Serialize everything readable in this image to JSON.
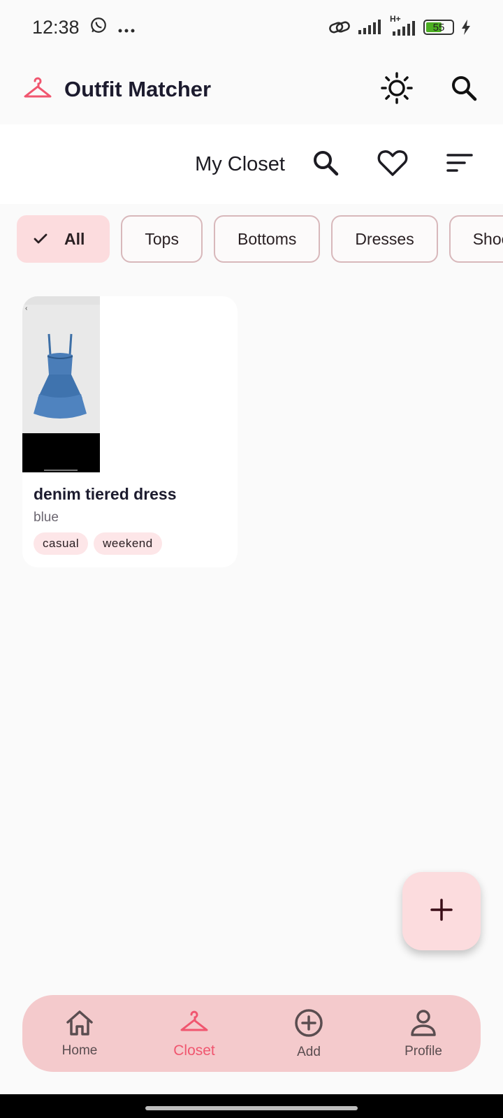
{
  "status_bar": {
    "time": "12:38",
    "notification_icons": [
      "whatsapp-icon",
      "more-dots-icon"
    ],
    "network_label": "H+",
    "battery_level": "55",
    "charging": true
  },
  "app_bar": {
    "title": "Outfit Matcher",
    "brand_color": "#f0566f"
  },
  "section": {
    "title": "My Closet"
  },
  "filters": {
    "chips": [
      {
        "label": "All",
        "selected": true
      },
      {
        "label": "Tops",
        "selected": false
      },
      {
        "label": "Bottoms",
        "selected": false
      },
      {
        "label": "Dresses",
        "selected": false
      },
      {
        "label": "Shoes",
        "selected": false
      }
    ]
  },
  "items": [
    {
      "name": "denim tiered dress",
      "color": "blue",
      "tags": [
        "casual",
        "weekend"
      ]
    }
  ],
  "fab": {
    "icon": "plus-icon"
  },
  "bottom_nav": {
    "items": [
      {
        "label": "Home",
        "icon": "home-icon",
        "active": false
      },
      {
        "label": "Closet",
        "icon": "hanger-icon",
        "active": true
      },
      {
        "label": "Add",
        "icon": "add-circle-icon",
        "active": false
      },
      {
        "label": "Profile",
        "icon": "profile-icon",
        "active": false
      }
    ]
  }
}
